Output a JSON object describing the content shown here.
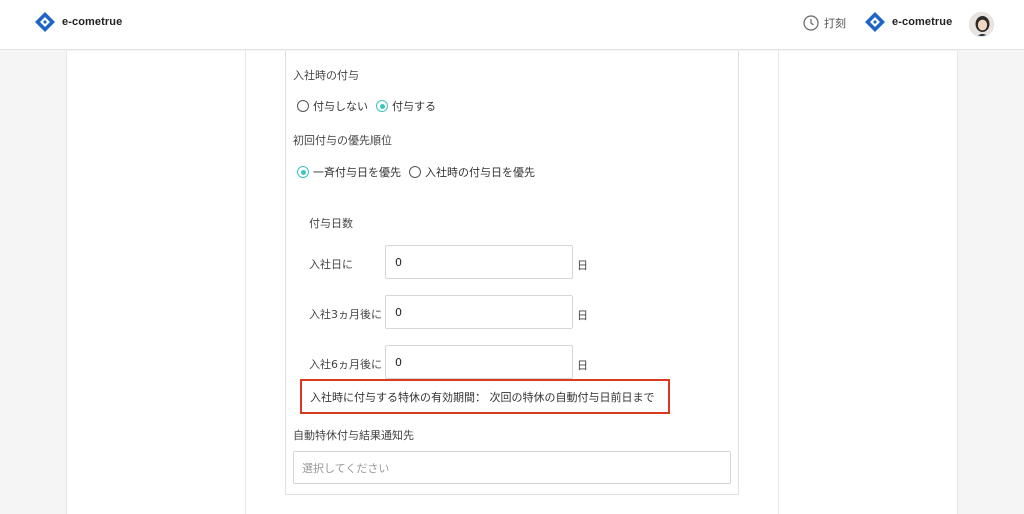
{
  "header": {
    "logo_text": "e-cometrue",
    "punch_label": "打刻",
    "brand_color": "#1f64c8"
  },
  "form": {
    "grant_on_join": {
      "label": "入社時の付与",
      "options": [
        {
          "label": "付与しない",
          "checked": false
        },
        {
          "label": "付与する",
          "checked": true
        }
      ]
    },
    "first_grant_priority": {
      "label": "初回付与の優先順位",
      "options": [
        {
          "label": "一斉付与日を優先",
          "checked": true
        },
        {
          "label": "入社時の付与日を優先",
          "checked": false
        }
      ]
    },
    "grant_days": {
      "label": "付与日数",
      "unit": "日",
      "rows": [
        {
          "label": "入社日に",
          "value": "0"
        },
        {
          "label": "入社3ヵ月後に",
          "value": "0"
        },
        {
          "label": "入社6ヵ月後に",
          "value": "0"
        }
      ]
    },
    "validity_note": "入社時に付与する特休の有効期間： 次回の特休の自動付与日前日まで",
    "notify": {
      "label": "自動特休付与結果通知先",
      "placeholder": "選択してください"
    }
  },
  "colors": {
    "accent": "#3fc4bf",
    "highlight_border": "#d9391f"
  }
}
